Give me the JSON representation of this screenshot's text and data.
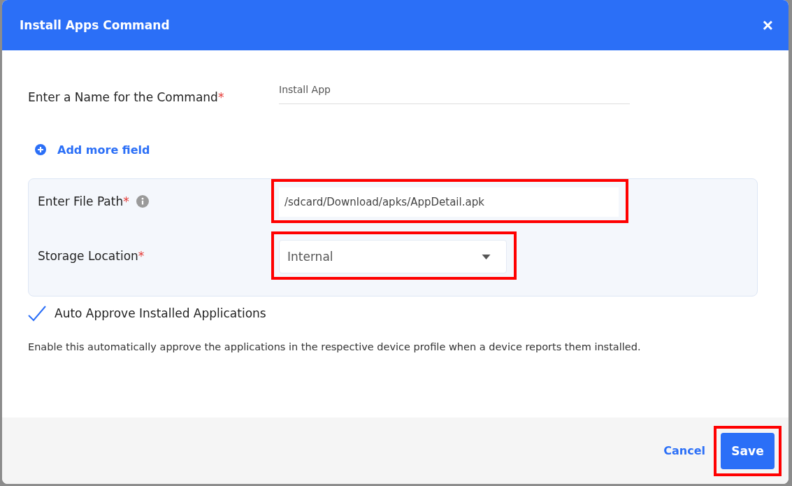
{
  "dialog": {
    "title": "Install Apps Command",
    "close_icon": "×"
  },
  "name_field": {
    "label": "Enter a Name for the Command",
    "required_mark": "*",
    "value": "Install App"
  },
  "add_field_link": "Add more field",
  "file_path": {
    "label": "Enter File Path",
    "required_mark": "*",
    "value": "/sdcard/Download/apks/AppDetail.apk",
    "highlighted": true
  },
  "storage_location": {
    "label": "Storage Location",
    "required_mark": "*",
    "value": "Internal",
    "highlighted": true
  },
  "auto_approve": {
    "label": "Auto Approve Installed Applications",
    "checked": true
  },
  "description": "Enable this automatically approve the applications in the respective device profile when a device reports them installed.",
  "buttons": [
    {
      "label": "Cancel",
      "kind": "link",
      "highlighted": false
    },
    {
      "label": "Save",
      "kind": "primary",
      "highlighted": true
    }
  ]
}
